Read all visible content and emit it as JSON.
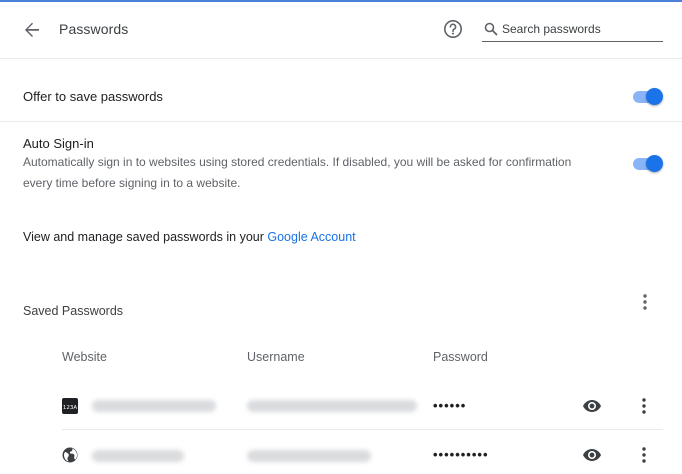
{
  "header": {
    "title": "Passwords",
    "search_placeholder": "Search passwords"
  },
  "settings": {
    "offer_to_save": {
      "label": "Offer to save passwords",
      "enabled": true
    },
    "auto_sign_in": {
      "label": "Auto Sign-in",
      "description": "Automatically sign in to websites using stored credentials. If disabled, you will be asked for confirmation every time before signing in to a website.",
      "enabled": true
    }
  },
  "manage": {
    "text": "View and manage saved passwords in your ",
    "link": "Google Account"
  },
  "saved": {
    "title": "Saved Passwords",
    "columns": {
      "website": "Website",
      "username": "Username",
      "password": "Password"
    },
    "rows": [
      {
        "icon": "123a-site-icon",
        "password_mask": "••••••"
      },
      {
        "icon": "globe-icon",
        "password_mask": "••••••••••"
      }
    ]
  },
  "colors": {
    "accent": "#1a73e8",
    "toggle_track": "#8ab4f8",
    "top_line": "#4a7fd8"
  }
}
